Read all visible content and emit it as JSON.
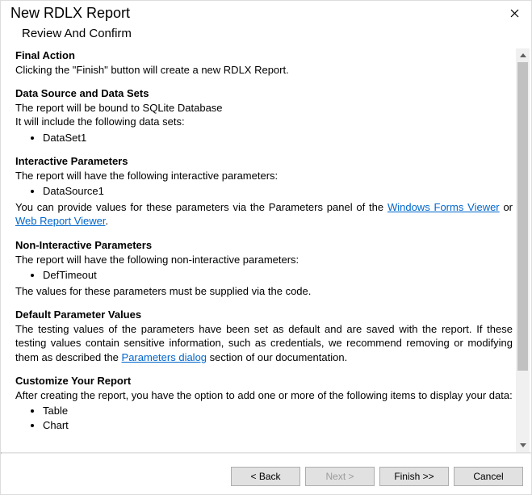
{
  "window": {
    "title": "New RDLX Report"
  },
  "subtitle": "Review And Confirm",
  "sections": {
    "final_action": {
      "head": "Final Action",
      "body": "Clicking the \"Finish\" button will create a new RDLX Report."
    },
    "data_source": {
      "head": "Data Source and Data Sets",
      "l1": "The report will be bound to SQLite Database",
      "l2": "It will include the following data sets:",
      "items": [
        "DataSet1"
      ]
    },
    "interactive": {
      "head": "Interactive Parameters",
      "l1": "The report will have the following interactive parameters:",
      "items": [
        "DataSource1"
      ],
      "l2a": "You can provide values for these parameters via the Parameters panel of the ",
      "link1": "Windows Forms Viewer",
      "l2b": " or ",
      "link2": "Web Report Viewer",
      "l2c": "."
    },
    "noninteractive": {
      "head": "Non-Interactive Parameters",
      "l1": "The report will have the following non-interactive parameters:",
      "items": [
        "DefTimeout"
      ],
      "l2": "The values for these parameters must be supplied via the code."
    },
    "defaults": {
      "head": "Default Parameter Values",
      "l1a": "The testing values of the parameters have been set as default and are saved with the report. If these testing values contain sensitive information, such as credentials, we recommend removing or modifying them as described the ",
      "link": "Parameters dialog",
      "l1b": " section of our documentation."
    },
    "customize": {
      "head": "Customize Your Report",
      "l1": "After creating the report, you have the option to add one or more of the following items to display your data:",
      "items": [
        "Table",
        "Chart"
      ]
    }
  },
  "buttons": {
    "back": "< Back",
    "next": "Next >",
    "finish": "Finish >>",
    "cancel": "Cancel"
  }
}
